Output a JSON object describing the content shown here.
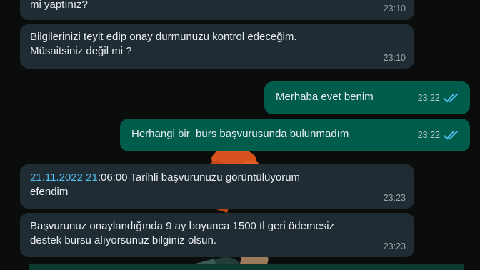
{
  "messages": [
    {
      "text": "mi yaptınız?",
      "time": "23:10"
    },
    {
      "text": "Bilgilerinizi teyit edip onay durmunuzu kontrol edeceğim.\nMüsaitsiniz değil mi ?",
      "time": "23:10"
    },
    {
      "text": "Merhaba evet benim",
      "time": "23:22"
    },
    {
      "text": "Herhangi bir  burs başvurusunda bulunmadım",
      "time": "23:22"
    },
    {
      "date_link": "21.11.2022 21",
      "text_rest": ":06:00 Tarihli başvurunuzu görüntülüyorum\nefendim",
      "time": "23:23"
    },
    {
      "text": "Başvurunuz onaylandığında 9 ay boyunca 1500 tl geri ödemesiz\ndestek bursu alıyorsunuz bilginiz olsun.",
      "time": "23:23"
    }
  ],
  "colors": {
    "incoming_bubble": "#202c33",
    "outgoing_bubble": "#005c4b",
    "read_ticks": "#53bdeb",
    "background": "#0b0d0c"
  },
  "icons": {
    "read_receipt": "double-check-icon"
  }
}
